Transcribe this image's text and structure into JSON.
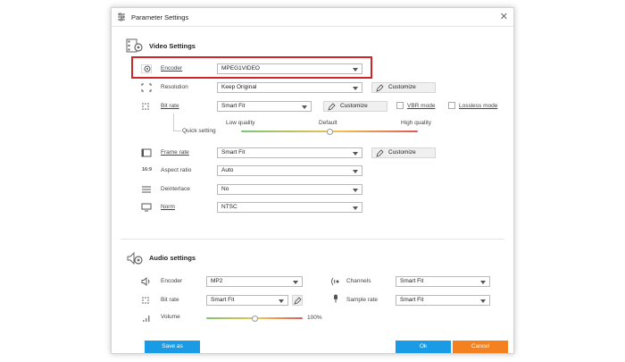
{
  "window": {
    "title": "Parameter Settings",
    "close_glyph": "✕"
  },
  "video": {
    "title": "Video Settings",
    "encoder": {
      "label": "Encoder",
      "value": "MPEG1VIDEO"
    },
    "resolution": {
      "label": "Resolution",
      "value": "Keep Original",
      "button": "Customize"
    },
    "bitrate": {
      "label": "Bit rate",
      "value": "Smart Fit",
      "button": "Customize",
      "vbr_label": "VBR mode",
      "lossless_label": "Lossless mode",
      "low": "Low quality",
      "default": "Default",
      "high": "High quality",
      "quick": "Quick setting",
      "quality_level": 0.5
    },
    "framerate": {
      "label": "Frame rate",
      "value": "Smart Fit",
      "button": "Customize"
    },
    "aspect": {
      "label": "Aspect ratio",
      "value": "Auto",
      "icon_text": "16:9"
    },
    "deinterlace": {
      "label": "Deinterlace",
      "value": "No"
    },
    "norm": {
      "label": "Norm",
      "value": "NTSC"
    }
  },
  "audio": {
    "title": "Audio settings",
    "encoder": {
      "label": "Encoder",
      "value": "MP2"
    },
    "bitrate": {
      "label": "Bit rate",
      "value": "Smart Fit"
    },
    "channels": {
      "label": "Channels",
      "value": "Smart Fit"
    },
    "samplerate": {
      "label": "Sample rate",
      "value": "Smart Fit"
    },
    "volume": {
      "label": "Volume",
      "value": "100%",
      "level": 0.5
    }
  },
  "footer": {
    "save_as": "Save as",
    "ok": "Ok",
    "cancel": "Cancel"
  },
  "colors": {
    "accent_blue": "#1a9be6",
    "cancel_orange": "#f5801f",
    "highlight_red": "#d0262a"
  }
}
